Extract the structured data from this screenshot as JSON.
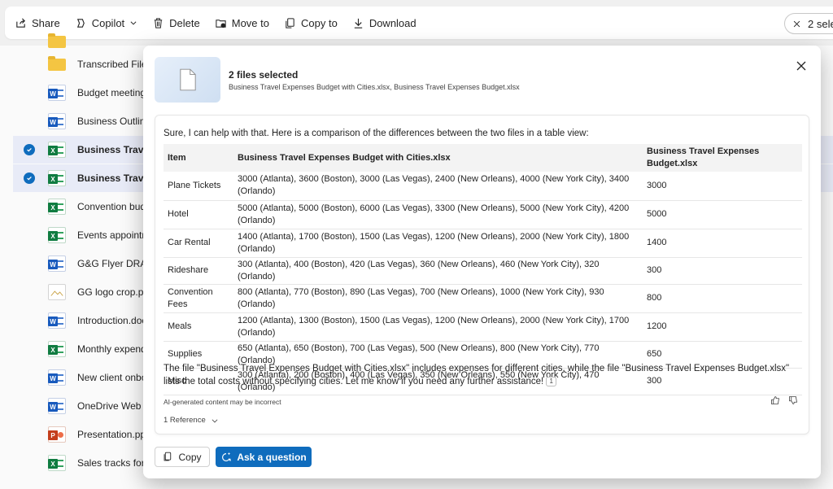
{
  "toolbar": {
    "share": "Share",
    "copilot": "Copilot",
    "delete": "Delete",
    "move_to": "Move to",
    "copy_to": "Copy to",
    "download": "Download",
    "selection": "2 sele"
  },
  "files": [
    {
      "name": "",
      "type": "folder",
      "selected": false
    },
    {
      "name": "Transcribed Files",
      "type": "folder",
      "selected": false
    },
    {
      "name": "Budget meeting",
      "type": "word",
      "selected": false
    },
    {
      "name": "Business Outline",
      "type": "word",
      "selected": false
    },
    {
      "name": "Business Travel",
      "type": "excel",
      "selected": true
    },
    {
      "name": "Business Travel",
      "type": "excel",
      "selected": true
    },
    {
      "name": "Convention bud",
      "type": "excel",
      "selected": false
    },
    {
      "name": "Events appointm",
      "type": "excel",
      "selected": false
    },
    {
      "name": "G&G Flyer DRAF",
      "type": "word",
      "selected": false
    },
    {
      "name": "GG logo crop.pn",
      "type": "image",
      "selected": false
    },
    {
      "name": "Introduction.doc",
      "type": "word",
      "selected": false
    },
    {
      "name": "Monthly expend",
      "type": "excel",
      "selected": false
    },
    {
      "name": "New client onbo",
      "type": "word",
      "selected": false
    },
    {
      "name": "OneDrive Web c",
      "type": "word",
      "selected": false
    },
    {
      "name": "Presentation.ppt",
      "type": "ppt",
      "selected": false
    },
    {
      "name": "Sales tracks for",
      "type": "excel",
      "selected": false
    }
  ],
  "dialog": {
    "title": "2 files selected",
    "subtitle": "Business Travel Expenses Budget with Cities.xlsx, Business Travel Expenses Budget.xlsx",
    "intro": "Sure, I can help with that. Here is a comparison of the differences between the two files in a table view:",
    "table": {
      "headers": [
        "Item",
        "Business Travel Expenses Budget with Cities.xlsx",
        "Business Travel Expenses Budget.xlsx"
      ],
      "rows": [
        [
          "Plane Tickets",
          "3000 (Atlanta), 3600 (Boston), 3000 (Las Vegas), 2400 (New Orleans), 4000 (New York City), 3400 (Orlando)",
          "3000"
        ],
        [
          "Hotel",
          "5000 (Atlanta), 5000 (Boston), 6000 (Las Vegas), 3300 (New Orleans), 5000 (New York City), 4200 (Orlando)",
          "5000"
        ],
        [
          "Car Rental",
          "1400 (Atlanta), 1700 (Boston), 1500 (Las Vegas), 1200 (New Orleans), 2000 (New York City), 1800 (Orlando)",
          "1400"
        ],
        [
          "Rideshare",
          "300 (Atlanta), 400 (Boston), 420 (Las Vegas), 360 (New Orleans), 460 (New York City), 320 (Orlando)",
          "300"
        ],
        [
          "Convention Fees",
          "800 (Atlanta), 770 (Boston), 890 (Las Vegas), 700 (New Orleans), 1000 (New York City), 930 (Orlando)",
          "800"
        ],
        [
          "Meals",
          "1200 (Atlanta), 1300 (Boston), 1500 (Las Vegas), 1200 (New Orleans), 2000 (New York City), 1700 (Orlando)",
          "1200"
        ],
        [
          "Supplies",
          "650 (Atlanta), 650 (Boston), 700 (Las Vegas), 500 (New Orleans), 800 (New York City), 770 (Orlando)",
          "650"
        ],
        [
          "Misc",
          "300 (Atlanta), 200 (Boston), 400 (Las Vegas), 350 (New Orleans), 550 (New York City), 470 (Orlando)",
          "300"
        ]
      ]
    },
    "outro": "The file \"Business Travel Expenses Budget with Cities.xlsx\" includes expenses for different cities, while the file \"Business Travel Expenses Budget.xlsx\" lists the total costs without specifying cities. Let me know if you need any further assistance!",
    "ref_marker": "1",
    "ai_note": "AI-generated content may be incorrect",
    "references": "1 Reference",
    "copy_label": "Copy",
    "ask_label": "Ask a question"
  },
  "colors": {
    "accent": "#0f6cbd",
    "selected_row": "#e8ebf7",
    "excel": "#107c41",
    "word": "#185abd",
    "powerpoint": "#c43e1c"
  }
}
